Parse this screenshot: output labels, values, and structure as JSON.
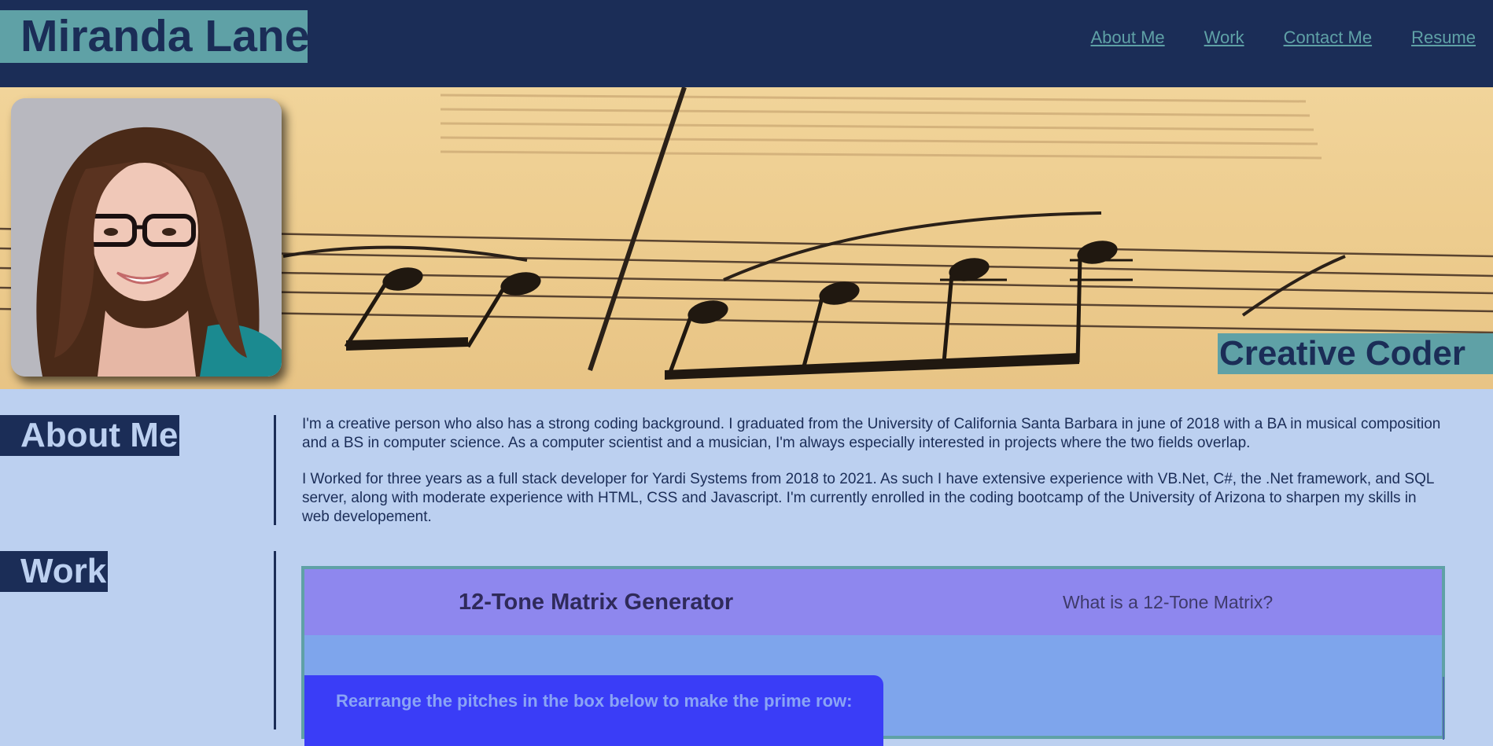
{
  "header": {
    "title": "Miranda Lane",
    "nav": [
      "About Me",
      "Work",
      "Contact Me",
      "Resume"
    ]
  },
  "hero": {
    "tagline": "Creative Coder"
  },
  "about": {
    "heading": "About Me",
    "paragraphs": [
      "I'm a creative person who also has a strong coding background. I graduated from the University of California Santa Barbara in june of 2018 with a BA in musical composition and a BS in computer science. As a computer scientist and a musician, I'm always especially interested in projects where the two fields overlap.",
      "I Worked for three years as a full stack developer for Yardi Systems from 2018 to 2021. As such I have extensive experience with VB.Net, C#, the .Net framework, and SQL server, along with moderate experience with HTML, CSS and Javascript. I'm currently enrolled in the coding bootcamp of the University of Arizona to sharpen my skills in web developement."
    ]
  },
  "work": {
    "heading": "Work",
    "project": {
      "title": "12-Tone Matrix Generator",
      "info_link": "What is a 12-Tone Matrix?",
      "instruction": "Rearrange the pitches in the box below to make the prime row:"
    }
  },
  "colors": {
    "navy": "#1b2d57",
    "teal": "#5fa1a6",
    "page_bg": "#bcd0f0",
    "card_head": "#8e87ee",
    "card_body": "#7ea5ec",
    "instruction_box": "#3a3df7"
  }
}
